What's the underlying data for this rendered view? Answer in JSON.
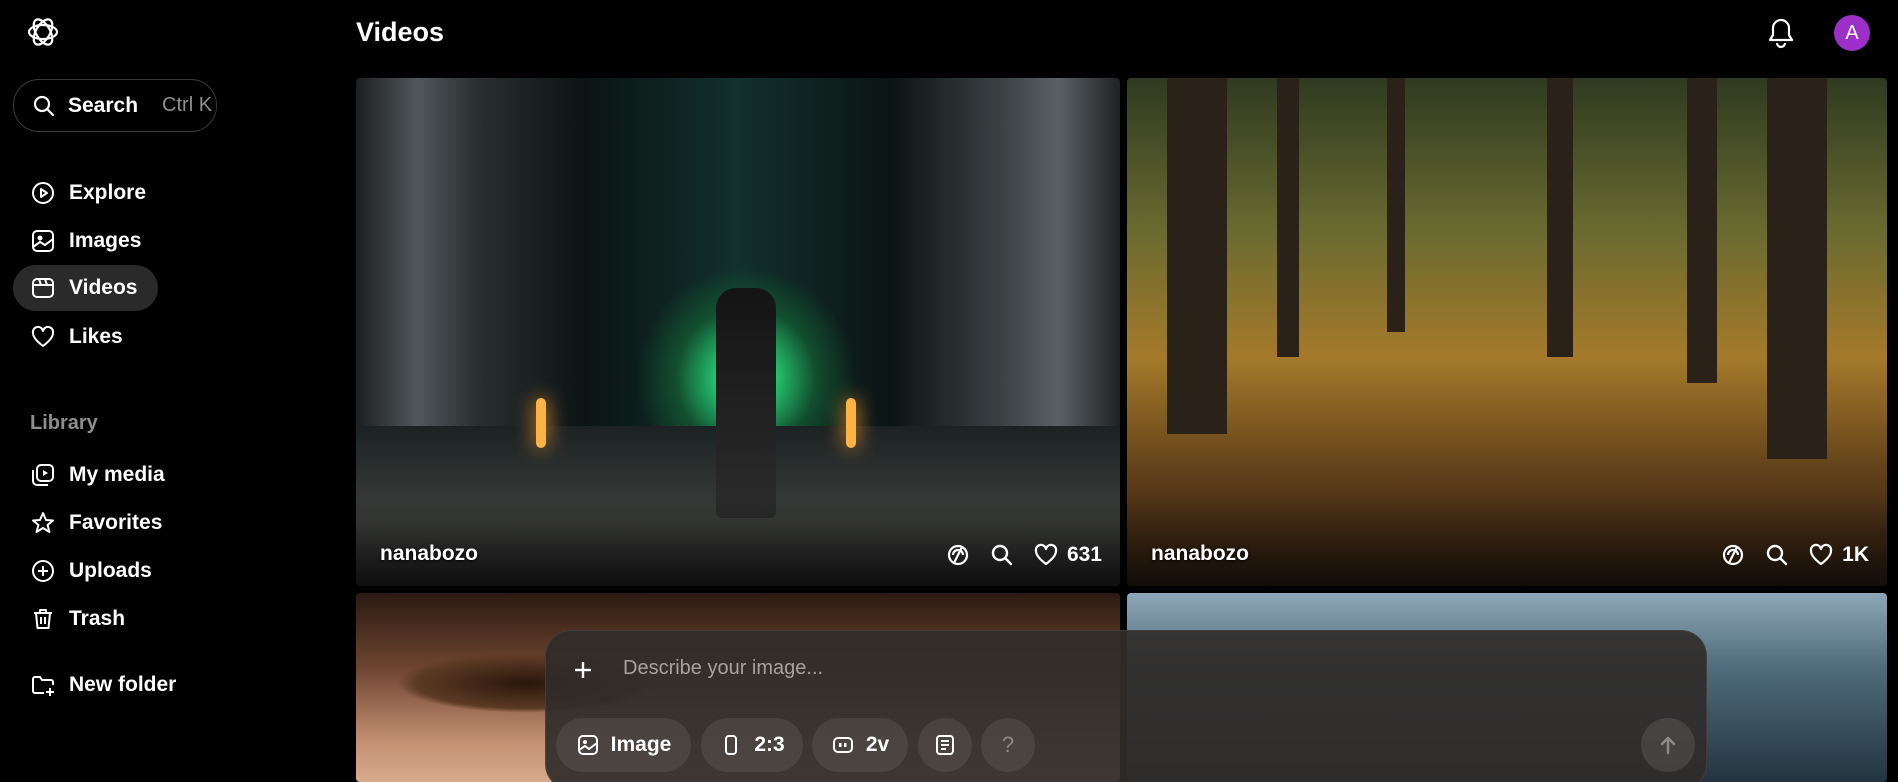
{
  "header": {
    "title": "Videos",
    "avatar_initial": "A"
  },
  "search": {
    "label": "Search",
    "shortcut": "Ctrl K"
  },
  "sidebar": {
    "items": [
      {
        "label": "Explore",
        "icon": "play-circle-icon"
      },
      {
        "label": "Images",
        "icon": "image-icon"
      },
      {
        "label": "Videos",
        "icon": "video-icon",
        "active": true
      },
      {
        "label": "Likes",
        "icon": "heart-icon"
      }
    ],
    "library_heading": "Library",
    "library_items": [
      {
        "label": "My media",
        "icon": "media-icon"
      },
      {
        "label": "Favorites",
        "icon": "star-icon"
      },
      {
        "label": "Uploads",
        "icon": "upload-icon"
      },
      {
        "label": "Trash",
        "icon": "trash-icon"
      }
    ],
    "new_folder": "New folder"
  },
  "grid": {
    "cards": [
      {
        "author": "nanabozo",
        "likes": "631"
      },
      {
        "author": "nanabozo",
        "likes": "1K"
      }
    ]
  },
  "composer": {
    "placeholder": "Describe your image...",
    "chips": {
      "type": "Image",
      "aspect": "2:3",
      "variations": "2v",
      "help": "?"
    }
  },
  "colors": {
    "accent": "#9b2fc7",
    "active_nav_bg": "#2a2a2a",
    "background": "#000000"
  }
}
